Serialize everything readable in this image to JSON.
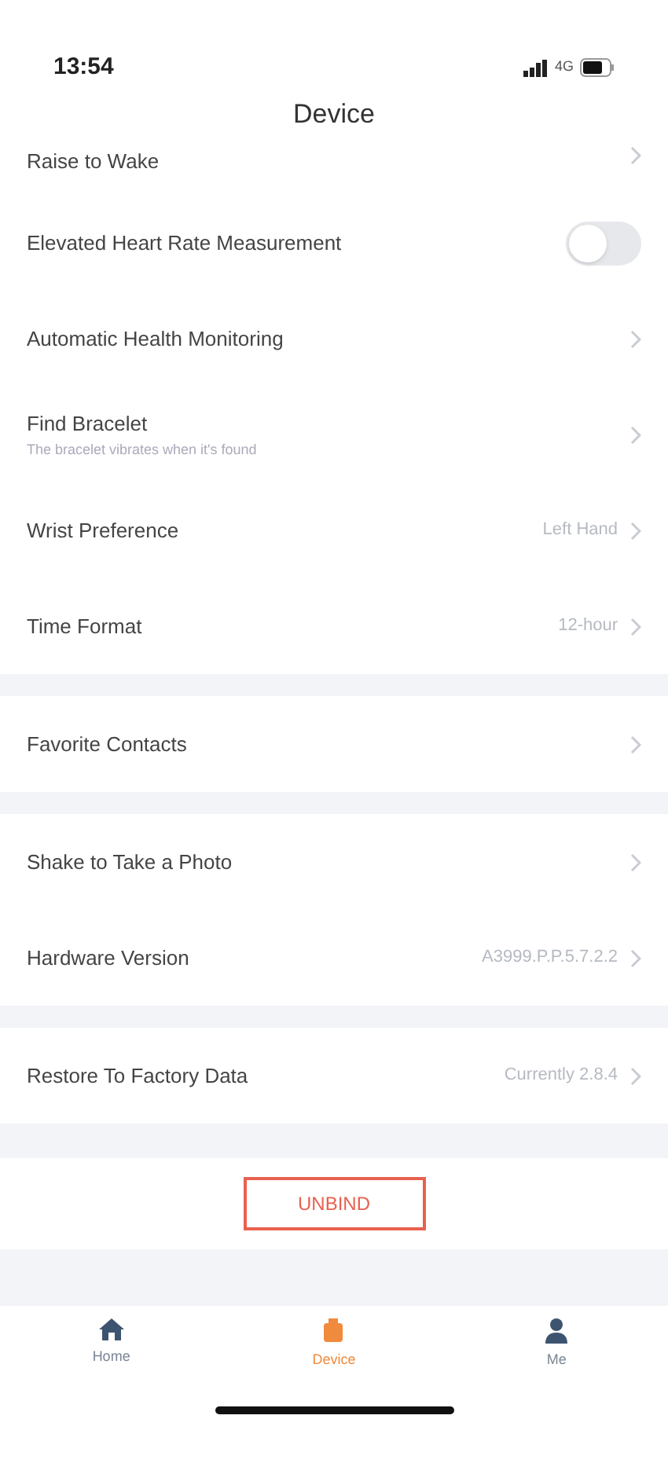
{
  "status_bar": {
    "time": "13:54",
    "network": "4G"
  },
  "title": "Device",
  "sections": [
    {
      "rows": [
        {
          "kind": "link",
          "label": "Raise to Wake"
        },
        {
          "kind": "toggle",
          "label": "Elevated Heart Rate Measurement",
          "on": false
        },
        {
          "kind": "link",
          "label": "Automatic Health Monitoring"
        },
        {
          "kind": "link",
          "label": "Find Bracelet",
          "subtitle": "The bracelet vibrates when it's found"
        },
        {
          "kind": "value",
          "label": "Wrist Preference",
          "value": "Left Hand"
        },
        {
          "kind": "value",
          "label": "Time Format",
          "value": "12-hour"
        }
      ]
    },
    {
      "rows": [
        {
          "kind": "link",
          "label": "Favorite Contacts"
        }
      ]
    },
    {
      "rows": [
        {
          "kind": "link",
          "label": "Shake to Take a Photo"
        },
        {
          "kind": "value",
          "label": "Hardware Version",
          "value": "A3999.P.P.5.7.2.2"
        }
      ]
    },
    {
      "rows": [
        {
          "kind": "value",
          "label": "Restore To Factory Data",
          "value": "Currently 2.8.4"
        }
      ]
    }
  ],
  "unbind_button": "UNBIND",
  "tabs": [
    {
      "label": "Home",
      "selected": false
    },
    {
      "label": "Device",
      "selected": true
    },
    {
      "label": "Me",
      "selected": false
    }
  ]
}
